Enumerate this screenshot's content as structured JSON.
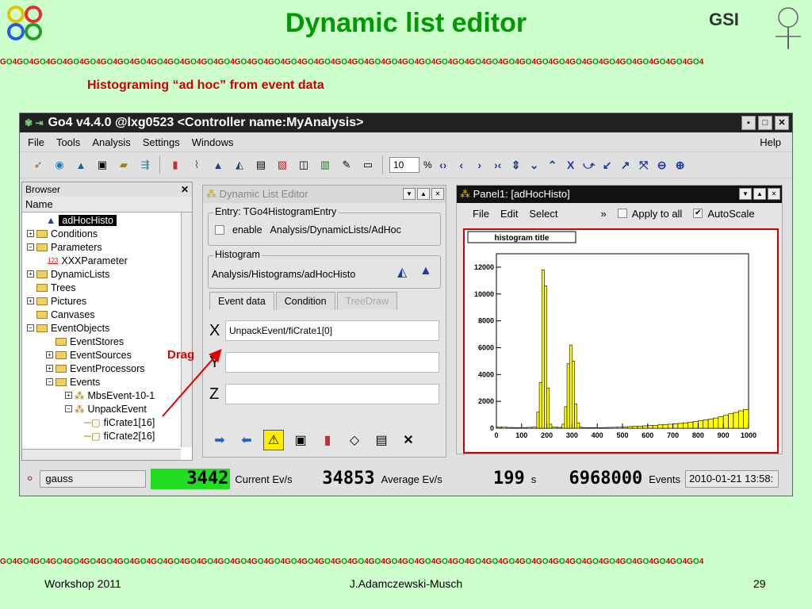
{
  "slide": {
    "title": "Dynamic list editor",
    "subtitle": "Histograming “ad hoc” from event data",
    "band_unit": "GO4",
    "footer_left": "Workshop 2011",
    "footer_center": "J.Adamczewski-Musch",
    "footer_right": "29",
    "drag_label": "Drag",
    "logo_text": "GSI"
  },
  "window": {
    "title": "Go4 v4.4.0 @lxg0523 <Controller name:MyAnalysis>",
    "menu": [
      "File",
      "Tools",
      "Analysis",
      "Settings",
      "Windows"
    ],
    "help": "Help",
    "toolbar_value": "10",
    "toolbar_percent": "%"
  },
  "browser": {
    "title": "Browser",
    "column": "Name",
    "items": [
      {
        "label": "adHocHisto",
        "selected": true
      },
      {
        "label": "Conditions"
      },
      {
        "label": "Parameters"
      },
      {
        "label": "XXXParameter"
      },
      {
        "label": "DynamicLists"
      },
      {
        "label": "Trees"
      },
      {
        "label": "Pictures"
      },
      {
        "label": "Canvases"
      },
      {
        "label": "EventObjects"
      },
      {
        "label": "EventStores"
      },
      {
        "label": "EventSources"
      },
      {
        "label": "EventProcessors"
      },
      {
        "label": "Events"
      },
      {
        "label": "MbsEvent-10-1"
      },
      {
        "label": "UnpackEvent"
      },
      {
        "label": "fiCrate1[16]"
      },
      {
        "label": "fiCrate2[16]"
      }
    ],
    "param_icon_text": "123"
  },
  "editor": {
    "title": "Dynamic List Editor",
    "entry_label": "Entry: TGo4HistogramEntry",
    "enable_label": "enable",
    "entry_path": "Analysis/DynamicLists/AdHoc",
    "histogram_label": "Histogram",
    "histogram_path": "Analysis/Histograms/adHocHisto",
    "tabs": [
      "Event data",
      "Condition",
      "TreeDraw"
    ],
    "x_label": "X",
    "y_label": "Y",
    "z_label": "Z",
    "x_value": "UnpackEvent/fiCrate1[0]",
    "y_value": "",
    "z_value": ""
  },
  "panel": {
    "title": "Panel1: [adHocHisto]",
    "menu": [
      "File",
      "Edit",
      "Select"
    ],
    "more": "»",
    "apply_all": "Apply to all",
    "autoscale": "AutoScale",
    "histo_title": "histogram title"
  },
  "chart_data": {
    "type": "bar",
    "title": "histogram title",
    "xlim": [
      0,
      1000
    ],
    "ylim": [
      0,
      13000
    ],
    "x_ticks": [
      0,
      100,
      200,
      300,
      400,
      500,
      600,
      700,
      800,
      900,
      1000
    ],
    "y_ticks": [
      0,
      2000,
      4000,
      6000,
      8000,
      10000,
      12000
    ],
    "bin_width": 20,
    "bins_x": [
      0,
      20,
      40,
      60,
      80,
      100,
      120,
      140,
      160,
      170,
      180,
      190,
      200,
      210,
      220,
      240,
      260,
      270,
      280,
      290,
      300,
      310,
      320,
      330,
      340,
      360,
      380,
      400,
      420,
      440,
      460,
      480,
      500,
      520,
      540,
      560,
      580,
      600,
      620,
      640,
      660,
      680,
      700,
      720,
      740,
      760,
      780,
      800,
      820,
      840,
      860,
      880,
      900,
      920,
      940,
      960,
      980
    ],
    "bins_y": [
      100,
      80,
      60,
      50,
      50,
      50,
      60,
      80,
      1200,
      3400,
      11800,
      10600,
      3000,
      300,
      100,
      60,
      300,
      1600,
      4800,
      6200,
      5000,
      1800,
      400,
      80,
      50,
      40,
      40,
      40,
      50,
      60,
      70,
      80,
      100,
      120,
      140,
      160,
      180,
      200,
      220,
      250,
      280,
      300,
      330,
      360,
      400,
      440,
      500,
      560,
      620,
      680,
      760,
      860,
      960,
      1080,
      1180,
      1300,
      1400
    ]
  },
  "status": {
    "name": "gauss",
    "counter1": "3442",
    "counter1_label": "Current Ev/s",
    "counter2": "34853",
    "counter2_label": "Average Ev/s",
    "counter3": "199",
    "counter3_unit": "s",
    "counter4": "6968000",
    "counter4_label": "Events",
    "timestamp": "2010-01-21 13:58:"
  },
  "colors": {
    "title_green": "#009900",
    "subtitle_red": "#cc0000",
    "histo_fill": "#ffff00",
    "lcd_green": "#22dd22"
  }
}
